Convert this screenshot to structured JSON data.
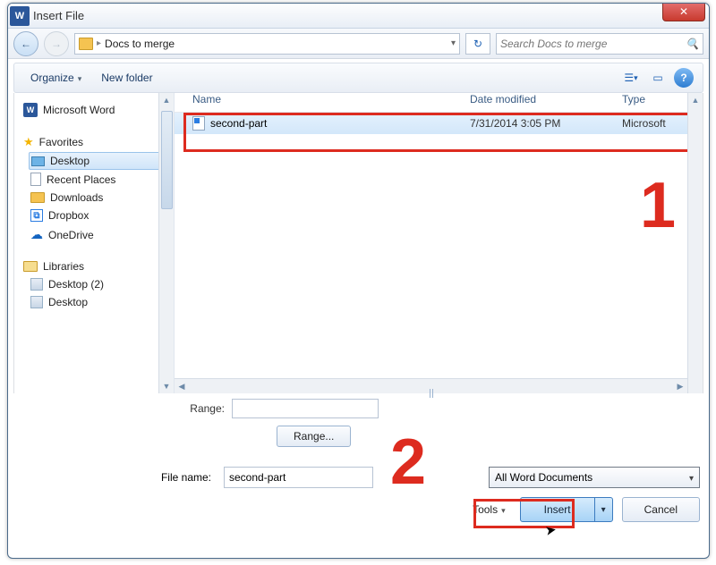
{
  "title": "Insert File",
  "close_glyph": "✕",
  "nav": {
    "back_glyph": "←",
    "fwd_glyph": "→",
    "loc": "Docs to merge",
    "sep": "▸",
    "refresh_glyph": "↻",
    "search_placeholder": "Search Docs to merge"
  },
  "toolbar": {
    "organize": "Organize",
    "newfolder": "New folder",
    "help_glyph": "?"
  },
  "side": {
    "word": "Microsoft Word",
    "favorites": "Favorites",
    "desktop": "Desktop",
    "recent": "Recent Places",
    "downloads": "Downloads",
    "dropbox": "Dropbox",
    "onedrive": "OneDrive",
    "libraries": "Libraries",
    "lib_desktop2": "Desktop (2)",
    "lib_desktop": "Desktop"
  },
  "cols": {
    "name": "Name",
    "date": "Date modified",
    "type": "Type"
  },
  "rows": [
    {
      "name": "second-part",
      "date": "7/31/2014 3:05 PM",
      "type": "Microsoft"
    }
  ],
  "range_label": "Range:",
  "range_btn": "Range...",
  "fn_label": "File name:",
  "fn_value": "second-part",
  "filter": "All Word Documents",
  "tools": "Tools",
  "insert": "Insert",
  "cancel": "Cancel",
  "annot": {
    "one": "1",
    "two": "2"
  }
}
